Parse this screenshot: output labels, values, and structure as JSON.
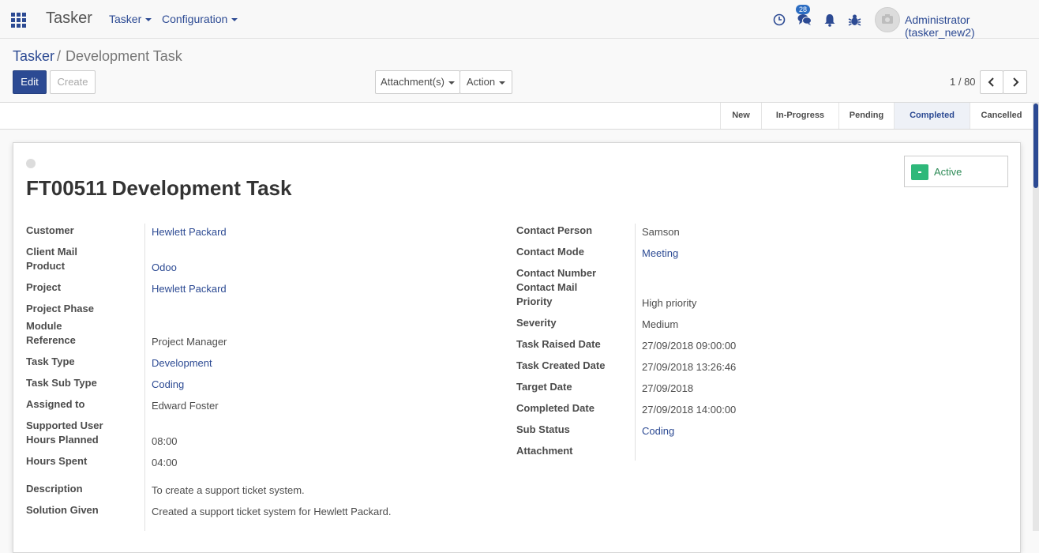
{
  "navbar": {
    "brand": "Tasker",
    "menus": [
      "Tasker",
      "Configuration"
    ],
    "message_badge": "28",
    "user": "Administrator (tasker_new2)"
  },
  "breadcrumb": {
    "root": "Tasker",
    "separator": "/",
    "current": "Development Task"
  },
  "buttons": {
    "edit": "Edit",
    "create": "Create",
    "attachments": "Attachment(s)",
    "action": "Action"
  },
  "pager": {
    "text": "1 / 80"
  },
  "stages": [
    "New",
    "In-Progress",
    "Pending",
    "Completed",
    "Cancelled"
  ],
  "active_stage": "Completed",
  "record": {
    "code": "FT00511",
    "name": "Development Task",
    "active_label": "Active"
  },
  "left_fields": {
    "customer": {
      "label": "Customer",
      "value": "Hewlett Packard"
    },
    "client_mail": {
      "label": "Client Mail",
      "value": ""
    },
    "product": {
      "label": "Product",
      "value": "Odoo"
    },
    "project": {
      "label": "Project",
      "value": "Hewlett Packard"
    },
    "project_phase": {
      "label": "Project Phase",
      "value": ""
    },
    "module": {
      "label": "Module",
      "value": ""
    },
    "reference": {
      "label": "Reference",
      "value": "Project Manager"
    },
    "task_type": {
      "label": "Task Type",
      "value": "Development"
    },
    "task_sub_type": {
      "label": "Task Sub Type",
      "value": "Coding"
    },
    "assigned_to": {
      "label": "Assigned to",
      "value": "Edward Foster"
    },
    "supported_user": {
      "label": "Supported User",
      "value": ""
    },
    "hours_planned": {
      "label": "Hours Planned",
      "value": "08:00"
    },
    "hours_spent": {
      "label": "Hours Spent",
      "value": "04:00"
    },
    "description": {
      "label": "Description",
      "value": "To create a support ticket system."
    },
    "solution": {
      "label": "Solution Given",
      "value": "Created a support ticket system for Hewlett Packard."
    }
  },
  "right_fields": {
    "contact_person": {
      "label": "Contact Person",
      "value": "Samson"
    },
    "contact_mode": {
      "label": "Contact Mode",
      "value": "Meeting"
    },
    "contact_number": {
      "label": "Contact Number",
      "value": ""
    },
    "contact_mail": {
      "label": "Contact Mail",
      "value": ""
    },
    "priority": {
      "label": "Priority",
      "value": "High priority"
    },
    "severity": {
      "label": "Severity",
      "value": "Medium"
    },
    "task_raised_date": {
      "label": "Task Raised Date",
      "value": "27/09/2018 09:00:00"
    },
    "task_created_date": {
      "label": "Task Created Date",
      "value": "27/09/2018 13:26:46"
    },
    "target_date": {
      "label": "Target Date",
      "value": "27/09/2018"
    },
    "completed_date": {
      "label": "Completed Date",
      "value": "27/09/2018 14:00:00"
    },
    "sub_status": {
      "label": "Sub Status",
      "value": "Coding"
    },
    "attachment": {
      "label": "Attachment",
      "value": ""
    }
  },
  "icons": {
    "apps": "apps-grid-icon",
    "activity": "clock-icon",
    "messages": "chat-bubbles-icon",
    "notifications": "bell-icon",
    "debug": "bug-icon",
    "avatar": "camera-avatar-icon"
  },
  "colors": {
    "primary": "#2c4a93",
    "active": "#2eb87a"
  }
}
